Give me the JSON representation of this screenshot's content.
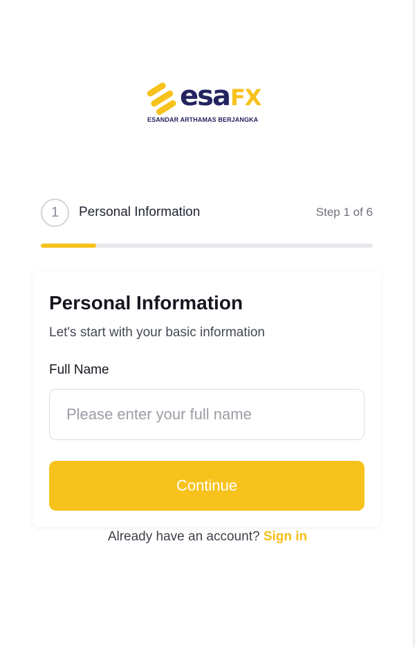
{
  "brand": {
    "name_part1": "esa",
    "name_part2": "FX",
    "tagline": "ESANDAR ARTHAMAS BERJANGKA",
    "colors": {
      "navy": "#23245f",
      "yellow": "#f6c21b"
    }
  },
  "stepper": {
    "step_number": "1",
    "title": "Personal Information",
    "step_text": "Step 1 of 6",
    "progress": {
      "current": 1,
      "total": 6
    }
  },
  "form": {
    "title": "Personal Information",
    "subtitle": "Let's start with your basic information",
    "full_name_label": "Full Name",
    "full_name_placeholder": "Please enter your full name",
    "full_name_value": "",
    "continue_label": "Continue"
  },
  "footer": {
    "prompt": "Already have an account?",
    "signin_label": "Sign in"
  },
  "colors": {
    "accent": "#f8c21c",
    "track": "#e8e8ec"
  }
}
